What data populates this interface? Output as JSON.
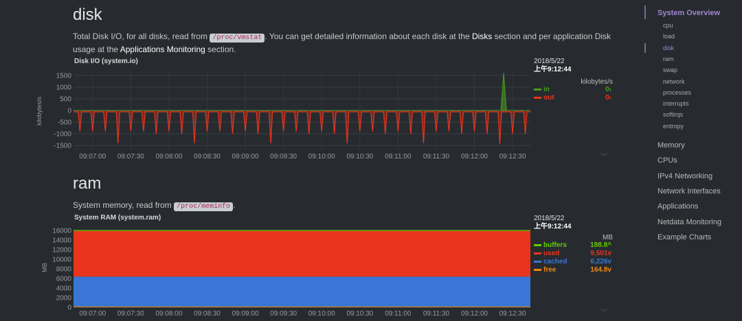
{
  "disk": {
    "title": "disk",
    "desc_1": "Total Disk I/O, for all disks, read from ",
    "desc_code": "/proc/vmstat",
    "desc_2": ". You can get detailed information about each disk at the ",
    "desc_link1": "Disks",
    "desc_3": " section and per application Disk usage at the ",
    "desc_link2": "Applications Monitoring",
    "desc_4": " section.",
    "chart_title": "Disk I/O (system.io)",
    "y_unit": "kilobytes/s",
    "legend": {
      "date": "2018/5/22",
      "time": "上午9:12:44",
      "units": "kilobytes/s",
      "rows": [
        {
          "name": "in",
          "value": "0",
          "arrow": "‹",
          "color": "#4a9a1e"
        },
        {
          "name": "out",
          "value": "0",
          "arrow": "‹",
          "color": "#e8351c"
        }
      ]
    }
  },
  "ram": {
    "title": "ram",
    "desc_1": "System memory, read from ",
    "desc_code": "/proc/meminfo",
    "desc_2": ".",
    "chart_title": "System RAM (system.ram)",
    "y_unit": "MB",
    "legend": {
      "date": "2018/5/22",
      "time": "上午9:12:44",
      "units": "MB",
      "rows": [
        {
          "name": "buffers",
          "value": "188.8",
          "arrow": "^",
          "color": "#66cc00"
        },
        {
          "name": "used",
          "value": "9,501",
          "arrow": "v",
          "color": "#e8351c"
        },
        {
          "name": "cached",
          "value": "6,226",
          "arrow": "v",
          "color": "#3a76d6"
        },
        {
          "name": "free",
          "value": "164.8",
          "arrow": "v",
          "color": "#ef8a10"
        }
      ]
    }
  },
  "chart_data": [
    {
      "type": "line",
      "title": "Disk I/O (system.io)",
      "ylabel": "kilobytes/s",
      "ylim": [
        -1700,
        1700
      ],
      "yticks": [
        1500,
        1000,
        500,
        0,
        -500,
        -1000,
        -1500
      ],
      "xticks": [
        "09:07:00",
        "09:07:30",
        "09:08:00",
        "09:08:30",
        "09:09:00",
        "09:09:30",
        "09:10:00",
        "09:10:30",
        "09:11:00",
        "09:11:30",
        "09:12:00",
        "09:12:30"
      ],
      "grid": true,
      "legend_position": "right",
      "series": [
        {
          "name": "in",
          "color": "#4a9a1e",
          "spikes": [
            {
              "t": "09:12:23",
              "value": 1600
            }
          ]
        },
        {
          "name": "out",
          "color": "#e8351c",
          "baseline": -60,
          "spikes_t": [
            "09:06:50",
            "09:07:00",
            "09:07:10",
            "09:07:20",
            "09:07:30",
            "09:07:40",
            "09:07:50",
            "09:08:00",
            "09:08:10",
            "09:08:20",
            "09:08:30",
            "09:08:40",
            "09:08:50",
            "09:09:00",
            "09:09:10",
            "09:09:20",
            "09:09:30",
            "09:09:40",
            "09:09:50",
            "09:10:00",
            "09:10:10",
            "09:10:20",
            "09:10:30",
            "09:10:40",
            "09:10:50",
            "09:11:00",
            "09:11:10",
            "09:11:20",
            "09:11:30",
            "09:11:40",
            "09:11:50",
            "09:12:00",
            "09:12:10",
            "09:12:20",
            "09:12:30",
            "09:12:40"
          ],
          "spikes_v": [
            -900,
            -900,
            -900,
            -1400,
            -900,
            -900,
            -1000,
            -900,
            -1000,
            -1400,
            -900,
            -900,
            -1000,
            -900,
            -1000,
            -1400,
            -900,
            -900,
            -1000,
            -900,
            -1000,
            -1400,
            -900,
            -900,
            -1000,
            -900,
            -1000,
            -1400,
            -900,
            -900,
            -1000,
            -900,
            -1000,
            -1450,
            -1000,
            -1000
          ]
        }
      ]
    },
    {
      "type": "area",
      "title": "System RAM (system.ram)",
      "ylabel": "MB",
      "ylim": [
        0,
        16000
      ],
      "yticks": [
        16000,
        14000,
        12000,
        10000,
        8000,
        6000,
        4000,
        2000,
        0
      ],
      "xticks": [
        "09:07:00",
        "09:07:30",
        "09:08:00",
        "09:08:30",
        "09:09:00",
        "09:09:30",
        "09:10:00",
        "09:10:30",
        "09:11:00",
        "09:11:30",
        "09:12:00",
        "09:12:30"
      ],
      "grid": true,
      "legend_position": "right",
      "stacked": true,
      "series": [
        {
          "name": "free",
          "value": 164.8,
          "color": "#ef8a10"
        },
        {
          "name": "cached",
          "value": 6226,
          "color": "#3a76d6"
        },
        {
          "name": "used",
          "value": 9501,
          "color": "#e8351c"
        },
        {
          "name": "buffers",
          "value": 188.8,
          "color": "#66cc00"
        }
      ]
    }
  ],
  "nav": {
    "main_top": "System Overview",
    "subs": [
      "cpu",
      "load",
      "disk",
      "ram",
      "swap",
      "network",
      "processes",
      "interrupts",
      "softirqs",
      "entropy"
    ],
    "active_sub": "disk",
    "sections": [
      "Memory",
      "CPUs",
      "IPv4 Networking",
      "Network Interfaces",
      "Applications",
      "Netdata Monitoring",
      "Example Charts"
    ]
  }
}
